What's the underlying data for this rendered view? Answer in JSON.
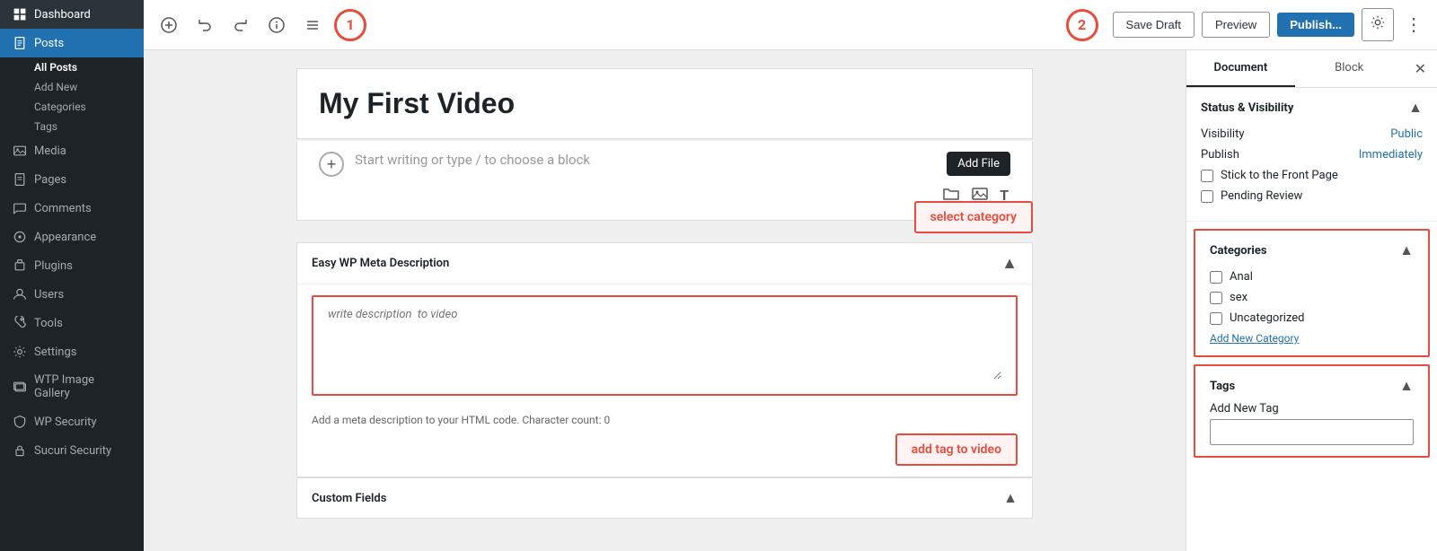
{
  "sidebar": {
    "brand": "Dashboard",
    "items": [
      {
        "id": "dashboard",
        "label": "Dashboard",
        "icon": "grid"
      },
      {
        "id": "posts",
        "label": "Posts",
        "icon": "document",
        "active": true
      },
      {
        "id": "media",
        "label": "Media",
        "icon": "image"
      },
      {
        "id": "pages",
        "label": "Pages",
        "icon": "page"
      },
      {
        "id": "comments",
        "label": "Comments",
        "icon": "comment"
      },
      {
        "id": "appearance",
        "label": "Appearance",
        "icon": "paint"
      },
      {
        "id": "plugins",
        "label": "Plugins",
        "icon": "plugin"
      },
      {
        "id": "users",
        "label": "Users",
        "icon": "user"
      },
      {
        "id": "tools",
        "label": "Tools",
        "icon": "wrench"
      },
      {
        "id": "settings",
        "label": "Settings",
        "icon": "gear"
      },
      {
        "id": "wtp-image-gallery",
        "label": "WTP Image Gallery",
        "icon": "gallery"
      },
      {
        "id": "wp-security",
        "label": "WP Security",
        "icon": "shield"
      },
      {
        "id": "sucuri-security",
        "label": "Sucuri Security",
        "icon": "lock"
      }
    ],
    "sub_items": [
      {
        "id": "all-posts",
        "label": "All Posts"
      },
      {
        "id": "add-new",
        "label": "Add New",
        "active": true
      },
      {
        "id": "categories",
        "label": "Categories"
      },
      {
        "id": "tags",
        "label": "Tags"
      }
    ]
  },
  "toolbar": {
    "add_block_title": "Add block",
    "undo_title": "Undo",
    "redo_title": "Redo",
    "info_title": "Details",
    "list_view_title": "List view",
    "save_draft_label": "Save Draft",
    "preview_label": "Preview",
    "publish_label": "Publish...",
    "settings_label": "Settings",
    "more_label": "More tools and options",
    "annotation_1": "1",
    "annotation_2": "2"
  },
  "editor": {
    "title": "My First Video",
    "body_placeholder": "Start writing or type / to choose a block",
    "add_file_tooltip": "Add File"
  },
  "meta_description": {
    "section_title": "Easy WP Meta Description",
    "textarea_placeholder": "write description  to video",
    "footer_text": "Add a meta description to your HTML code. Character count: 0"
  },
  "custom_fields": {
    "section_title": "Custom Fields"
  },
  "annotations": {
    "select_category": "select category",
    "add_tag": "add tag to video",
    "write_description": "write description  to video"
  },
  "panel": {
    "document_tab": "Document",
    "block_tab": "Block",
    "status_section_title": "Status & Visibility",
    "visibility_label": "Visibility",
    "visibility_value": "Public",
    "publish_label": "Publish",
    "publish_value": "Immediately",
    "stick_front_page_label": "Stick to the Front Page",
    "pending_review_label": "Pending Review",
    "categories_section_title": "Categories",
    "categories": [
      {
        "id": "anal",
        "label": "Anal",
        "checked": false
      },
      {
        "id": "sex",
        "label": "sex",
        "checked": false
      },
      {
        "id": "uncategorized",
        "label": "Uncategorized",
        "checked": false
      }
    ],
    "add_new_category_label": "Add New Category",
    "tags_section_title": "Tags",
    "tags_toggle": "^",
    "add_new_tag_label": "Add New Tag",
    "tags_input_placeholder": ""
  }
}
